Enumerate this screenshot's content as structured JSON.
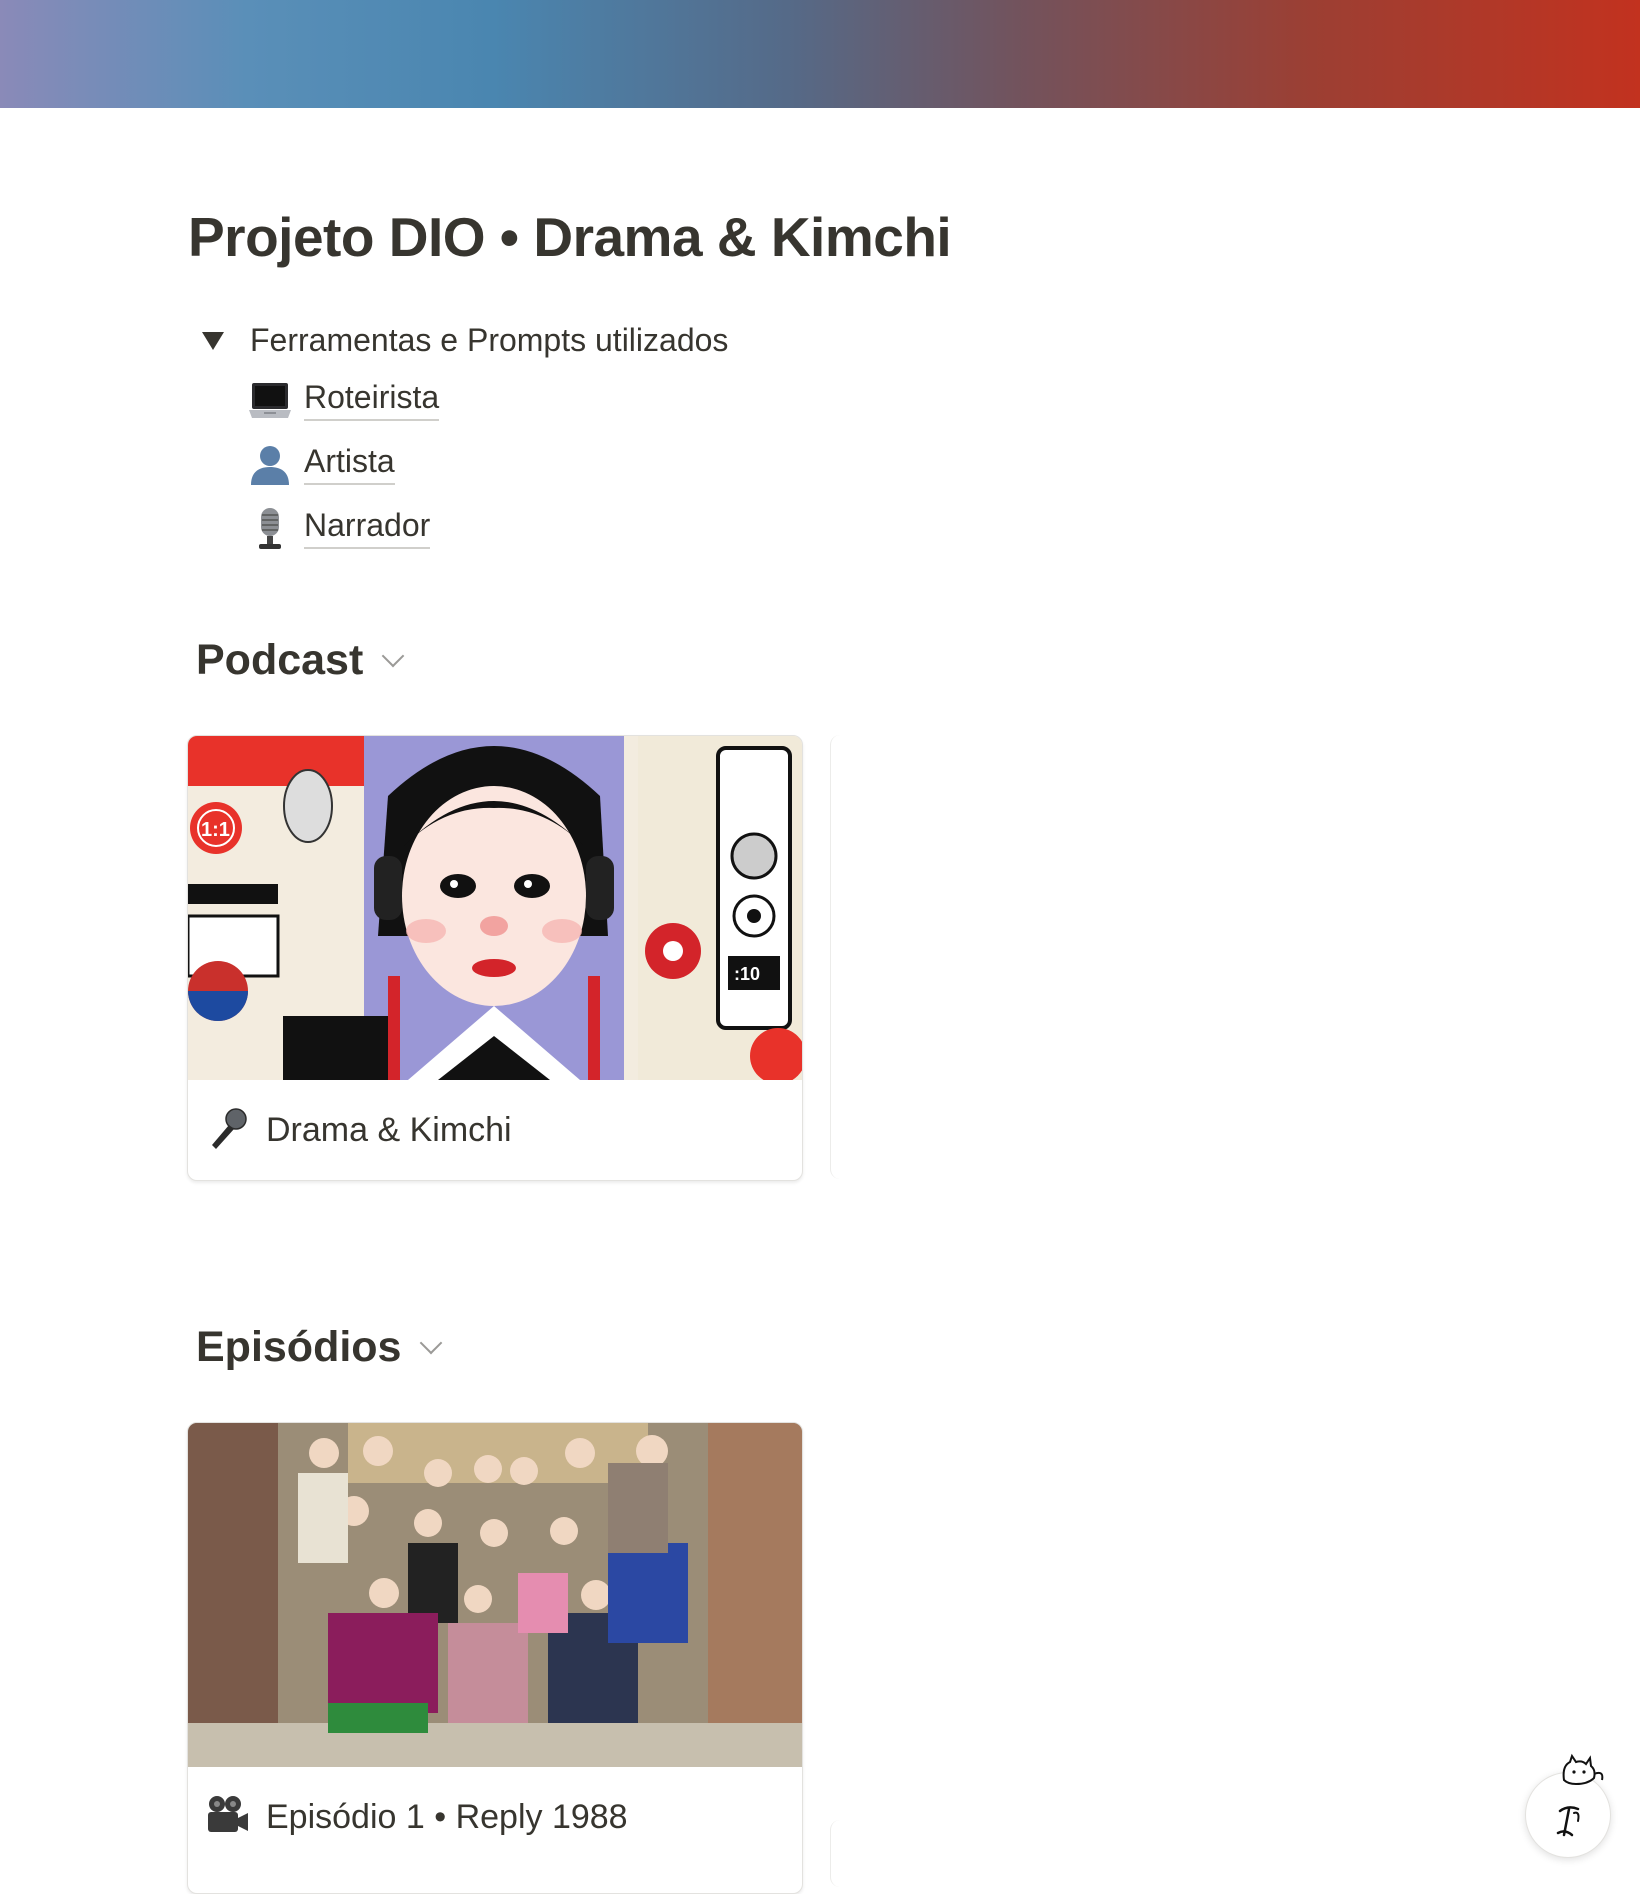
{
  "page": {
    "title": "Projeto DIO • Drama & Kimchi",
    "cover_colors": [
      "#8a8ab8",
      "#4a86b0",
      "#72535d",
      "#c2321f"
    ]
  },
  "toggle": {
    "label": "Ferramentas e Prompts utilizados",
    "expanded": true,
    "items": [
      {
        "icon": "laptop-icon",
        "label": "Roteirista"
      },
      {
        "icon": "person-silhouette-icon",
        "label": "Artista"
      },
      {
        "icon": "microphone-studio-icon",
        "label": "Narrador"
      }
    ]
  },
  "sections": {
    "podcast": {
      "heading": "Podcast",
      "card": {
        "icon": "microphone-icon",
        "title": "Drama & Kimchi",
        "image": "podcast-cover-illustration"
      }
    },
    "episodes": {
      "heading": "Episódios",
      "card": {
        "icon": "movie-camera-icon",
        "title": "Episódio 1 • Reply 1988",
        "image": "reply-1988-cast-photo"
      }
    }
  },
  "help": {
    "icon": "notion-help-icon"
  }
}
